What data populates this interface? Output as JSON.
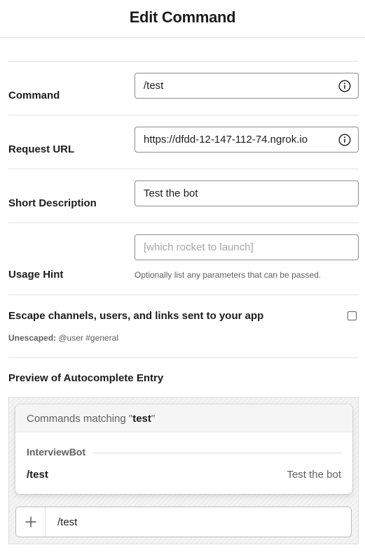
{
  "header": {
    "title": "Edit Command"
  },
  "form": {
    "command": {
      "label": "Command",
      "value": "/test"
    },
    "request_url": {
      "label": "Request URL",
      "value": "https://dfdd-12-147-112-74.ngrok.io"
    },
    "short_description": {
      "label": "Short Description",
      "value": "Test the bot"
    },
    "usage_hint": {
      "label": "Usage Hint",
      "value": "",
      "placeholder": "[which rocket to launch]",
      "help": "Optionally list any parameters that can be passed."
    },
    "escape": {
      "label": "Escape channels, users, and links sent to your app",
      "checked": false,
      "note_label": "Unescaped:",
      "note_value": " @user #general"
    }
  },
  "preview": {
    "title": "Preview of Autocomplete Entry",
    "matching_prefix": "Commands matching \"",
    "matching_term": "test",
    "matching_suffix": "\"",
    "group_name": "InterviewBot",
    "command_name": "/test",
    "command_desc": "Test the bot",
    "composer_text": "/test"
  },
  "icons": {
    "info": "info-icon",
    "plus": "plus-icon"
  },
  "colors": {
    "text": "#1d1c1d",
    "muted": "#616061",
    "border": "#8d8d8d"
  }
}
